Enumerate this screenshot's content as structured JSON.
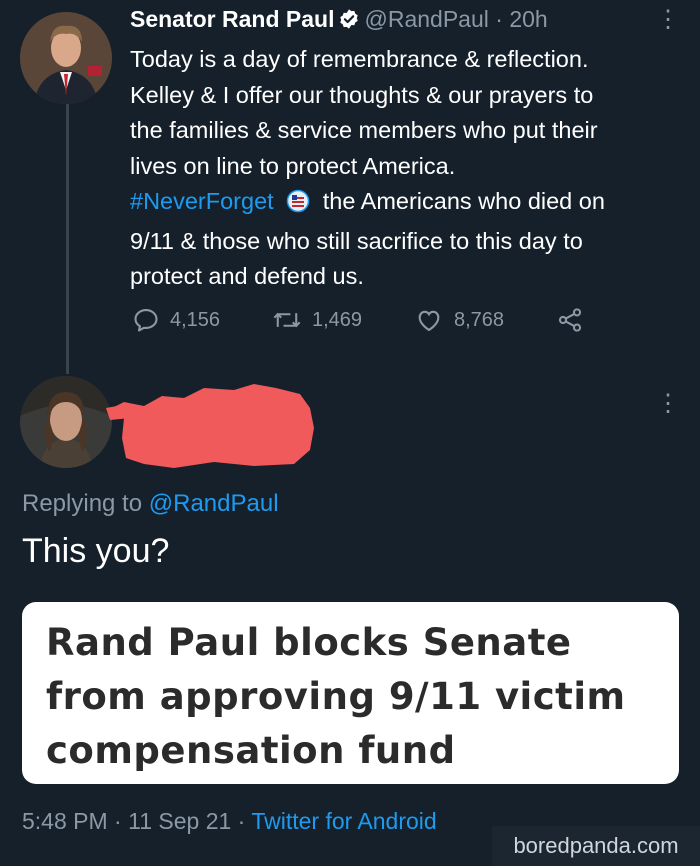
{
  "tweet": {
    "author_name": "Senator Rand Paul",
    "handle": "@RandPaul",
    "separator": "·",
    "time": "20h",
    "text_lines": [
      "Today is a day of remembrance & reflection.",
      "Kelley & I offer our thoughts & our prayers to",
      "the families & service members who put their",
      "lives on line to protect America."
    ],
    "hashtag": "#NeverForget",
    "text_after_hashtag": "the Americans who died on",
    "text_lines_end": [
      "9/11 & those who still sacrifice to this day to",
      "protect and defend us."
    ],
    "replies": "4,156",
    "retweets": "1,469",
    "likes": "8,768"
  },
  "reply": {
    "replying_label": "Replying to",
    "replying_handle": "@RandPaul",
    "text": "This you?",
    "card_headline_lines": [
      "Rand Paul blocks Senate",
      "from approving 9/11 victim",
      "compensation fund"
    ],
    "time": "5:48 PM",
    "separator": "·",
    "date": "11 Sep 21",
    "client": "Twitter for Android"
  },
  "watermark": "boredpanda.com",
  "colors": {
    "background": "#15202b",
    "link": "#1d9bf0",
    "muted": "#8b98a5",
    "redaction": "#f05a5a"
  }
}
